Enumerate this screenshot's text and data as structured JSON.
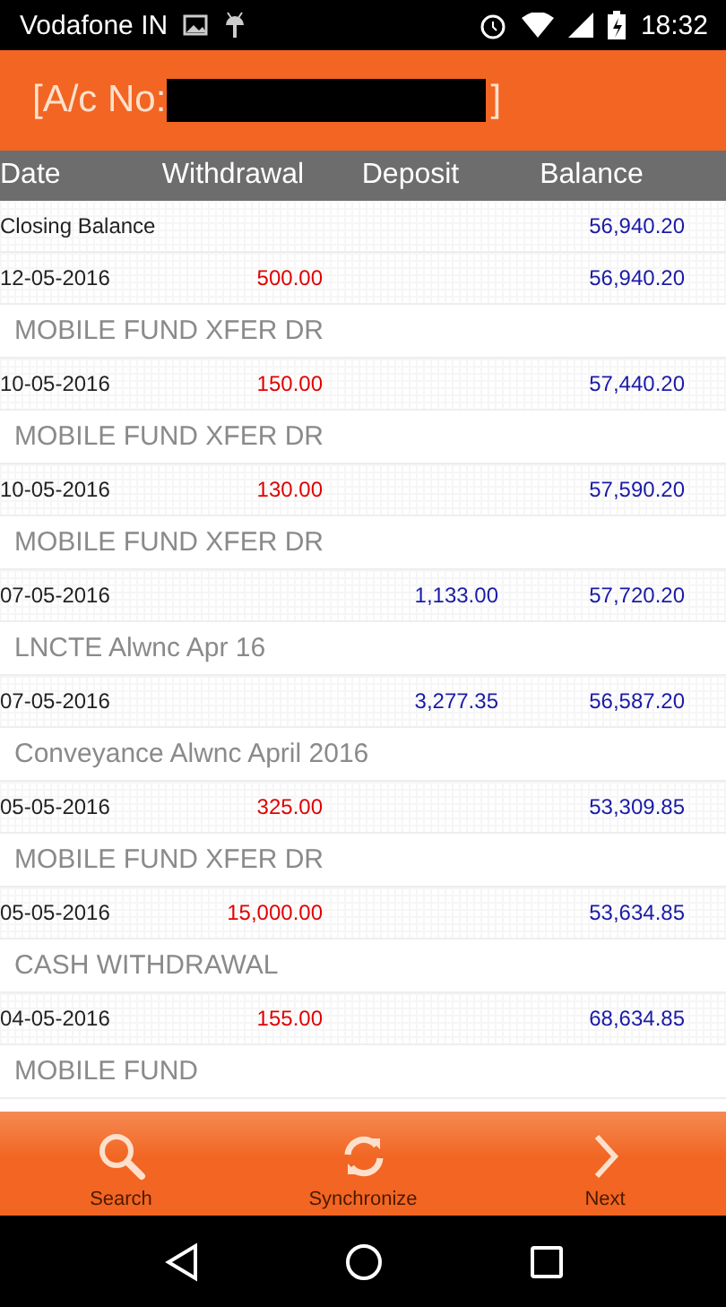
{
  "status_bar": {
    "carrier": "Vodafone IN",
    "time": "18:32"
  },
  "header": {
    "title_prefix": "[A/c No:",
    "title_suffix": "]",
    "redacted": true
  },
  "table": {
    "columns": [
      "Date",
      "Withdrawal",
      "Deposit",
      "Balance"
    ],
    "closing": {
      "label": "Closing Balance",
      "balance": "56,940.20"
    },
    "rows": [
      {
        "date": "12-05-2016",
        "withdrawal": "500.00",
        "balance": "56,940.20",
        "description": "MOBILE FUND XFER DR"
      },
      {
        "date": "10-05-2016",
        "withdrawal": "150.00",
        "balance": "57,440.20",
        "description": "MOBILE FUND XFER DR"
      },
      {
        "date": "10-05-2016",
        "withdrawal": "130.00",
        "balance": "57,590.20",
        "description": "MOBILE FUND XFER DR"
      },
      {
        "date": "07-05-2016",
        "deposit": "1,133.00",
        "balance": "57,720.20",
        "description": "LNCTE Alwnc Apr 16"
      },
      {
        "date": "07-05-2016",
        "deposit": "3,277.35",
        "balance": "56,587.20",
        "description": "Conveyance Alwnc April 2016"
      },
      {
        "date": "05-05-2016",
        "withdrawal": "325.00",
        "balance": "53,309.85",
        "description": "MOBILE FUND XFER DR"
      },
      {
        "date": "05-05-2016",
        "withdrawal": "15,000.00",
        "balance": "53,634.85",
        "description": "CASH WITHDRAWAL"
      },
      {
        "date": "04-05-2016",
        "withdrawal": "155.00",
        "balance": "68,634.85",
        "description": "MOBILE FUND"
      }
    ]
  },
  "toolbar": [
    {
      "kind": "search",
      "label": "Search"
    },
    {
      "kind": "sync",
      "label": "Synchronize"
    },
    {
      "kind": "next",
      "label": "Next"
    }
  ]
}
